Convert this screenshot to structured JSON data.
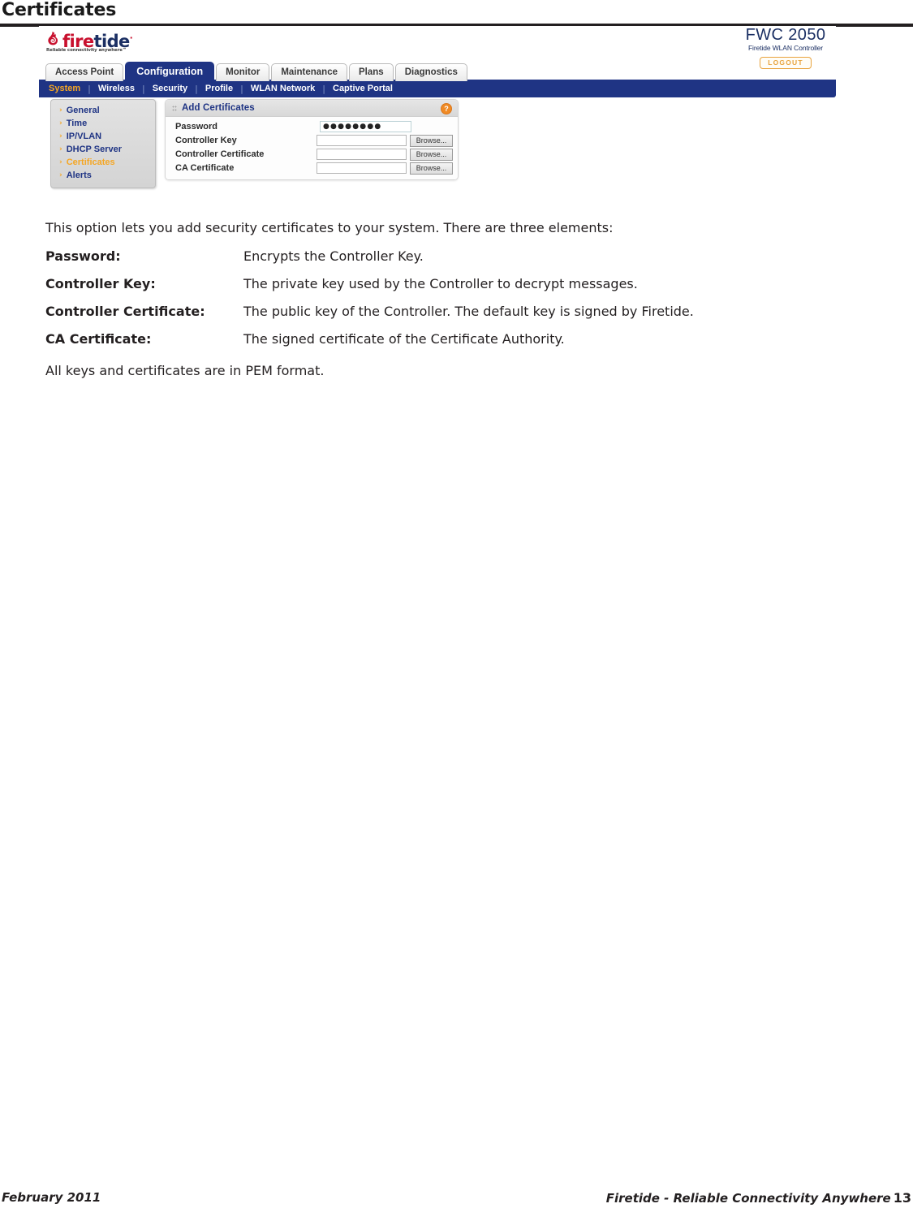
{
  "document": {
    "heading": "Certificates"
  },
  "screenshot": {
    "logo": {
      "fire_text": "fire",
      "tide_text": "tide",
      "trademark": "·",
      "tagline": "Reliable connectivity anywhere™"
    },
    "product": {
      "name": "FWC 2050",
      "subtitle": "Firetide WLAN Controller",
      "logout_label": "LOGOUT"
    },
    "tabs": [
      {
        "label": "Access Point",
        "active": false
      },
      {
        "label": "Configuration",
        "active": true
      },
      {
        "label": "Monitor",
        "active": false
      },
      {
        "label": "Maintenance",
        "active": false
      },
      {
        "label": "Plans",
        "active": false
      },
      {
        "label": "Diagnostics",
        "active": false
      }
    ],
    "subnav": [
      {
        "label": "System",
        "active": true
      },
      {
        "label": "Wireless",
        "active": false
      },
      {
        "label": "Security",
        "active": false
      },
      {
        "label": "Profile",
        "active": false
      },
      {
        "label": "WLAN Network",
        "active": false
      },
      {
        "label": "Captive Portal",
        "active": false
      }
    ],
    "sidebar": [
      {
        "label": "General",
        "active": false
      },
      {
        "label": "Time",
        "active": false
      },
      {
        "label": "IP/VLAN",
        "active": false
      },
      {
        "label": "DHCP Server",
        "active": false
      },
      {
        "label": "Certificates",
        "active": true
      },
      {
        "label": "Alerts",
        "active": false
      }
    ],
    "panel": {
      "title": "Add Certificates",
      "help_glyph": "?",
      "rows": [
        {
          "label": "Password",
          "value": "●●●●●●●●",
          "has_browse": false,
          "browse_label": ""
        },
        {
          "label": "Controller Key",
          "value": "",
          "has_browse": true,
          "browse_label": "Browse..."
        },
        {
          "label": "Controller Certificate",
          "value": "",
          "has_browse": true,
          "browse_label": "Browse..."
        },
        {
          "label": "CA Certificate",
          "value": "",
          "has_browse": true,
          "browse_label": "Browse..."
        }
      ]
    },
    "colors": {
      "navy": "#1f3484",
      "orange_accent": "#f5a623",
      "logo_red": "#c8102e",
      "help_orange": "#f08a24"
    }
  },
  "prose": {
    "intro": "This option lets you add security certificates to your system. There are three elements:",
    "definitions": [
      {
        "term": "Password:",
        "description": "Encrypts the Controller Key."
      },
      {
        "term": "Controller Key:",
        "description": "The private key used by the Controller to decrypt messages."
      },
      {
        "term": "Controller Certificate:",
        "description": "The public key of the Controller. The default key is signed by Firetide."
      },
      {
        "term": "CA Certificate:",
        "description": "The signed certificate of the Certificate Authority."
      }
    ],
    "closing": "All keys and certificates are in PEM format."
  },
  "footer": {
    "left": "February 2011",
    "right": "Firetide - Reliable Connectivity Anywhere",
    "page_number": "13"
  }
}
